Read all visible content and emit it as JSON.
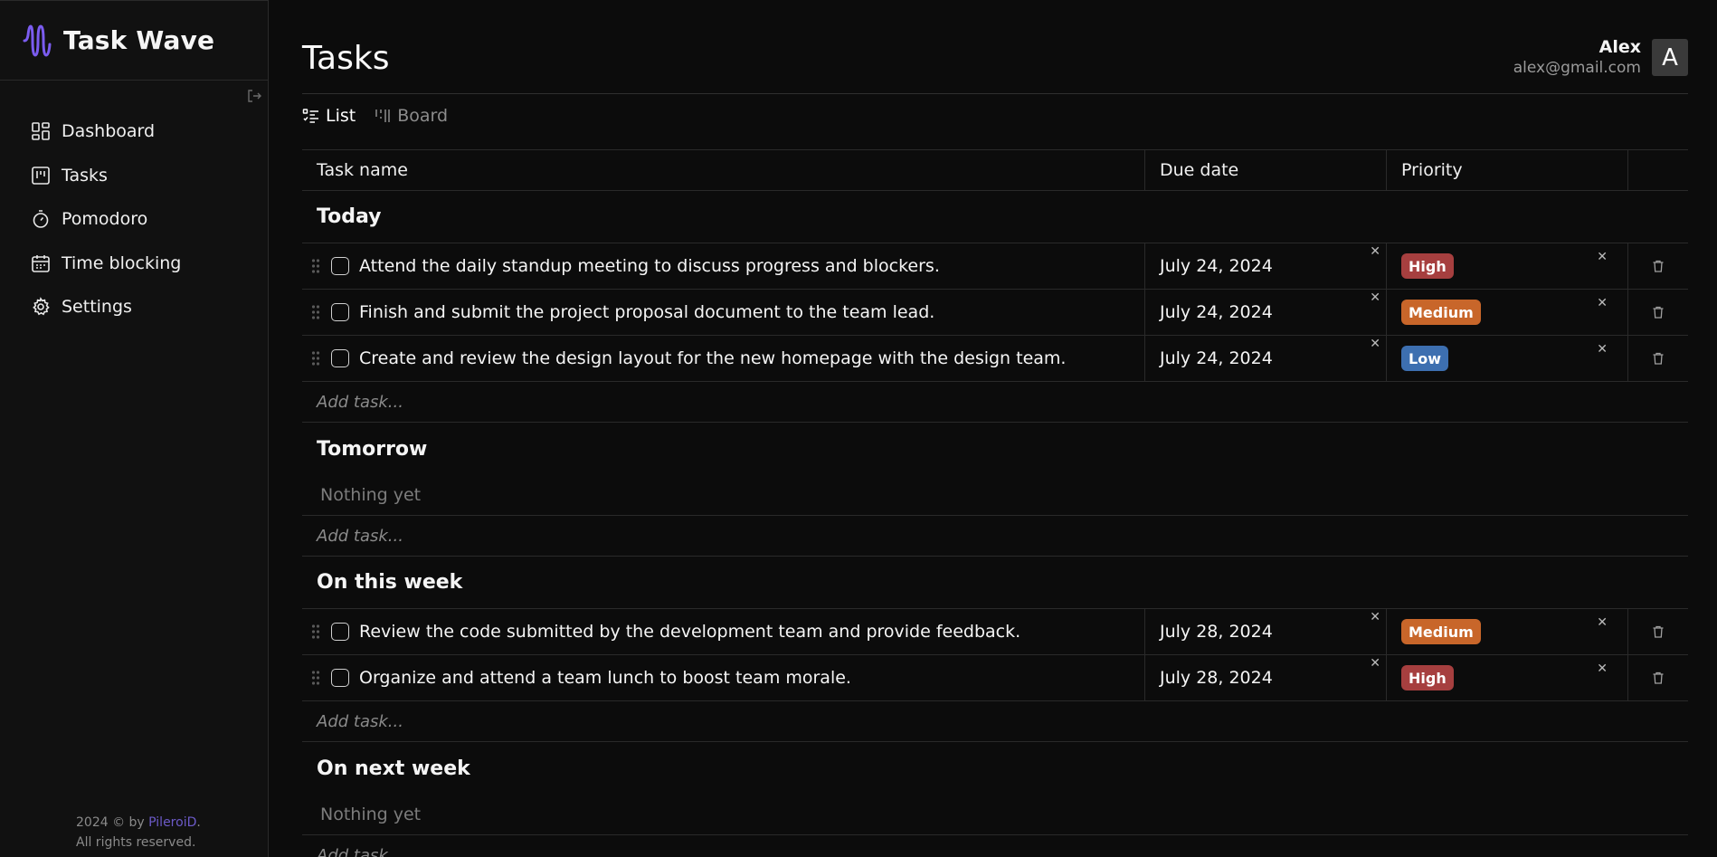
{
  "app": {
    "name": "Task Wave",
    "accent": "#7b5cf0"
  },
  "sidebar": {
    "items": [
      {
        "label": "Dashboard",
        "icon": "dashboard-icon"
      },
      {
        "label": "Tasks",
        "icon": "kanban-icon"
      },
      {
        "label": "Pomodoro",
        "icon": "timer-icon"
      },
      {
        "label": "Time blocking",
        "icon": "calendar-icon"
      },
      {
        "label": "Settings",
        "icon": "gear-icon"
      }
    ],
    "footer": {
      "line1_prefix": "2024 © by ",
      "author": "PileroiD",
      "line1_suffix": ".",
      "line2": "All rights reserved."
    }
  },
  "header": {
    "title": "Tasks",
    "user": {
      "name": "Alex",
      "email": "alex@gmail.com",
      "avatar_letter": "A"
    }
  },
  "views": [
    {
      "label": "List",
      "active": true
    },
    {
      "label": "Board",
      "active": false
    }
  ],
  "table": {
    "columns": [
      "Task name",
      "Due date",
      "Priority"
    ],
    "add_task_placeholder": "Add task...",
    "empty_label": "Nothing yet",
    "groups": [
      {
        "title": "Today",
        "tasks": [
          {
            "name": "Attend the daily standup meeting to discuss progress and blockers.",
            "due": "July 24, 2024",
            "priority": "High"
          },
          {
            "name": "Finish and submit the project proposal document to the team lead.",
            "due": "July 24, 2024",
            "priority": "Medium"
          },
          {
            "name": "Create and review the design layout for the new homepage with the design team.",
            "due": "July 24, 2024",
            "priority": "Low"
          }
        ]
      },
      {
        "title": "Tomorrow",
        "tasks": []
      },
      {
        "title": "On this week",
        "tasks": [
          {
            "name": "Review the code submitted by the development team and provide feedback.",
            "due": "July 28, 2024",
            "priority": "Medium"
          },
          {
            "name": "Organize and attend a team lunch to boost team morale.",
            "due": "July 28, 2024",
            "priority": "High"
          }
        ]
      },
      {
        "title": "On next week",
        "tasks": []
      }
    ]
  },
  "priority_colors": {
    "High": "#a63f3f",
    "Medium": "#c8662a",
    "Low": "#3d6fb0"
  }
}
